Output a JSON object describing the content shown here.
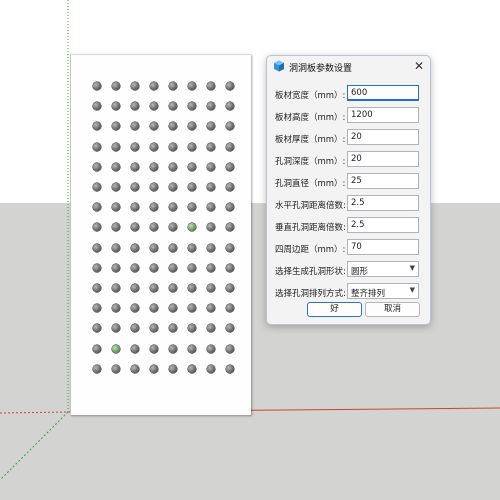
{
  "dialog": {
    "title": "洞洞板参数设置",
    "close_glyph": "✕",
    "fields": [
      {
        "label": "板材宽度（mm）:",
        "value": "600"
      },
      {
        "label": "板材高度（mm）:",
        "value": "1200"
      },
      {
        "label": "板材厚度（mm）:",
        "value": "20"
      },
      {
        "label": "孔洞深度（mm）:",
        "value": "20"
      },
      {
        "label": "孔洞直径（mm）:",
        "value": "25"
      },
      {
        "label": "水平孔洞距离倍数:",
        "value": "2.5"
      },
      {
        "label": "垂直孔洞距离倍数:",
        "value": "2.5"
      },
      {
        "label": "四周边距（mm）:",
        "value": "70"
      }
    ],
    "selects": [
      {
        "label": "选择生成孔洞形状:",
        "value": "圆形"
      },
      {
        "label": "选择孔洞排列方式:",
        "value": "整齐排列"
      }
    ],
    "ok_label": "好",
    "cancel_label": "取消"
  },
  "scene": {
    "hole_grid": {
      "columns": 8,
      "rows": 15
    },
    "highlighted_holes": [
      [
        7,
        5
      ],
      [
        13,
        1
      ]
    ],
    "colors": {
      "sky": "#ffffff",
      "ground": "#d3d3d1",
      "red_axis": "#d04040",
      "green_axis": "#3aa04a",
      "accent": "#1f6fcf"
    }
  }
}
